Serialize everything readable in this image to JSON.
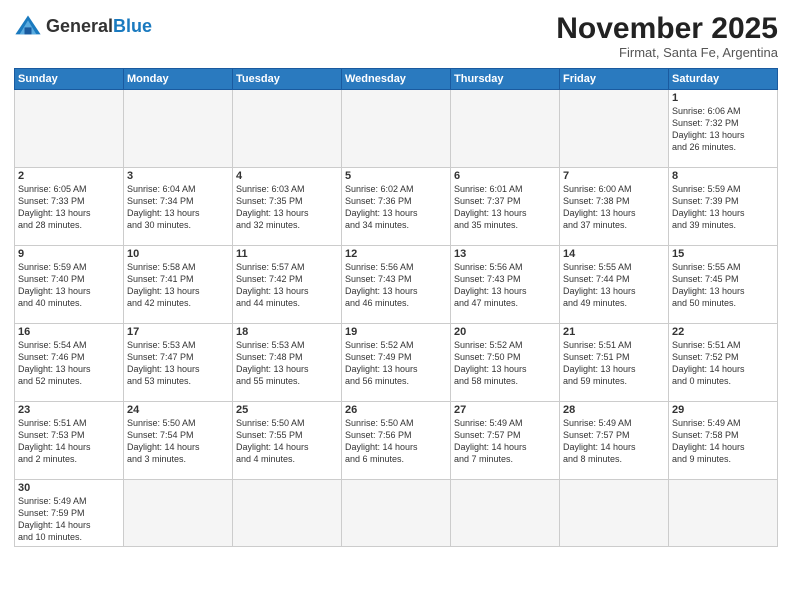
{
  "logo": {
    "general": "General",
    "blue": "Blue"
  },
  "title": "November 2025",
  "subtitle": "Firmat, Santa Fe, Argentina",
  "days_header": [
    "Sunday",
    "Monday",
    "Tuesday",
    "Wednesday",
    "Thursday",
    "Friday",
    "Saturday"
  ],
  "weeks": [
    [
      {
        "day": "",
        "info": ""
      },
      {
        "day": "",
        "info": ""
      },
      {
        "day": "",
        "info": ""
      },
      {
        "day": "",
        "info": ""
      },
      {
        "day": "",
        "info": ""
      },
      {
        "day": "",
        "info": ""
      },
      {
        "day": "1",
        "info": "Sunrise: 6:06 AM\nSunset: 7:32 PM\nDaylight: 13 hours\nand 26 minutes."
      }
    ],
    [
      {
        "day": "2",
        "info": "Sunrise: 6:05 AM\nSunset: 7:33 PM\nDaylight: 13 hours\nand 28 minutes."
      },
      {
        "day": "3",
        "info": "Sunrise: 6:04 AM\nSunset: 7:34 PM\nDaylight: 13 hours\nand 30 minutes."
      },
      {
        "day": "4",
        "info": "Sunrise: 6:03 AM\nSunset: 7:35 PM\nDaylight: 13 hours\nand 32 minutes."
      },
      {
        "day": "5",
        "info": "Sunrise: 6:02 AM\nSunset: 7:36 PM\nDaylight: 13 hours\nand 34 minutes."
      },
      {
        "day": "6",
        "info": "Sunrise: 6:01 AM\nSunset: 7:37 PM\nDaylight: 13 hours\nand 35 minutes."
      },
      {
        "day": "7",
        "info": "Sunrise: 6:00 AM\nSunset: 7:38 PM\nDaylight: 13 hours\nand 37 minutes."
      },
      {
        "day": "8",
        "info": "Sunrise: 5:59 AM\nSunset: 7:39 PM\nDaylight: 13 hours\nand 39 minutes."
      }
    ],
    [
      {
        "day": "9",
        "info": "Sunrise: 5:59 AM\nSunset: 7:40 PM\nDaylight: 13 hours\nand 40 minutes."
      },
      {
        "day": "10",
        "info": "Sunrise: 5:58 AM\nSunset: 7:41 PM\nDaylight: 13 hours\nand 42 minutes."
      },
      {
        "day": "11",
        "info": "Sunrise: 5:57 AM\nSunset: 7:42 PM\nDaylight: 13 hours\nand 44 minutes."
      },
      {
        "day": "12",
        "info": "Sunrise: 5:56 AM\nSunset: 7:43 PM\nDaylight: 13 hours\nand 46 minutes."
      },
      {
        "day": "13",
        "info": "Sunrise: 5:56 AM\nSunset: 7:43 PM\nDaylight: 13 hours\nand 47 minutes."
      },
      {
        "day": "14",
        "info": "Sunrise: 5:55 AM\nSunset: 7:44 PM\nDaylight: 13 hours\nand 49 minutes."
      },
      {
        "day": "15",
        "info": "Sunrise: 5:55 AM\nSunset: 7:45 PM\nDaylight: 13 hours\nand 50 minutes."
      }
    ],
    [
      {
        "day": "16",
        "info": "Sunrise: 5:54 AM\nSunset: 7:46 PM\nDaylight: 13 hours\nand 52 minutes."
      },
      {
        "day": "17",
        "info": "Sunrise: 5:53 AM\nSunset: 7:47 PM\nDaylight: 13 hours\nand 53 minutes."
      },
      {
        "day": "18",
        "info": "Sunrise: 5:53 AM\nSunset: 7:48 PM\nDaylight: 13 hours\nand 55 minutes."
      },
      {
        "day": "19",
        "info": "Sunrise: 5:52 AM\nSunset: 7:49 PM\nDaylight: 13 hours\nand 56 minutes."
      },
      {
        "day": "20",
        "info": "Sunrise: 5:52 AM\nSunset: 7:50 PM\nDaylight: 13 hours\nand 58 minutes."
      },
      {
        "day": "21",
        "info": "Sunrise: 5:51 AM\nSunset: 7:51 PM\nDaylight: 13 hours\nand 59 minutes."
      },
      {
        "day": "22",
        "info": "Sunrise: 5:51 AM\nSunset: 7:52 PM\nDaylight: 14 hours\nand 0 minutes."
      }
    ],
    [
      {
        "day": "23",
        "info": "Sunrise: 5:51 AM\nSunset: 7:53 PM\nDaylight: 14 hours\nand 2 minutes."
      },
      {
        "day": "24",
        "info": "Sunrise: 5:50 AM\nSunset: 7:54 PM\nDaylight: 14 hours\nand 3 minutes."
      },
      {
        "day": "25",
        "info": "Sunrise: 5:50 AM\nSunset: 7:55 PM\nDaylight: 14 hours\nand 4 minutes."
      },
      {
        "day": "26",
        "info": "Sunrise: 5:50 AM\nSunset: 7:56 PM\nDaylight: 14 hours\nand 6 minutes."
      },
      {
        "day": "27",
        "info": "Sunrise: 5:49 AM\nSunset: 7:57 PM\nDaylight: 14 hours\nand 7 minutes."
      },
      {
        "day": "28",
        "info": "Sunrise: 5:49 AM\nSunset: 7:57 PM\nDaylight: 14 hours\nand 8 minutes."
      },
      {
        "day": "29",
        "info": "Sunrise: 5:49 AM\nSunset: 7:58 PM\nDaylight: 14 hours\nand 9 minutes."
      }
    ],
    [
      {
        "day": "30",
        "info": "Sunrise: 5:49 AM\nSunset: 7:59 PM\nDaylight: 14 hours\nand 10 minutes."
      },
      {
        "day": "",
        "info": ""
      },
      {
        "day": "",
        "info": ""
      },
      {
        "day": "",
        "info": ""
      },
      {
        "day": "",
        "info": ""
      },
      {
        "day": "",
        "info": ""
      },
      {
        "day": "",
        "info": ""
      }
    ]
  ]
}
